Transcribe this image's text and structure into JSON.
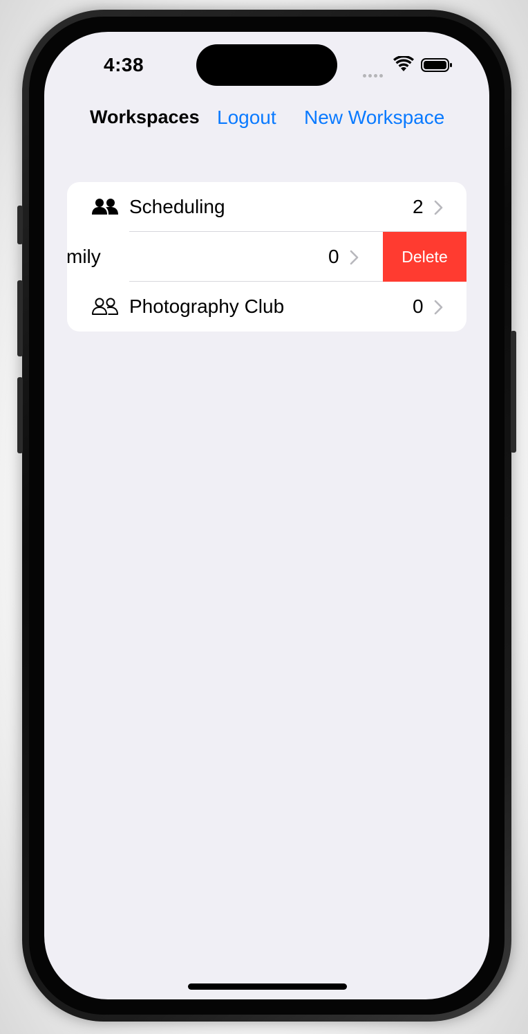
{
  "status_bar": {
    "time": "4:38",
    "wifi_icon": "wifi-icon",
    "battery_icon": "battery-icon"
  },
  "nav": {
    "title": "Workspaces",
    "logout_label": "Logout",
    "new_workspace_label": "New Workspace"
  },
  "workspaces": [
    {
      "name": "Scheduling",
      "count": "2",
      "icon": "people-filled-icon"
    },
    {
      "name": "mily",
      "count": "0",
      "icon": ""
    },
    {
      "name": "Photography Club",
      "count": "0",
      "icon": "people-outline-icon"
    }
  ],
  "row_actions": {
    "delete_label": "Delete"
  },
  "colors": {
    "accent": "#0a7aff",
    "destructive": "#ff3b30",
    "background": "#f0eff5"
  }
}
